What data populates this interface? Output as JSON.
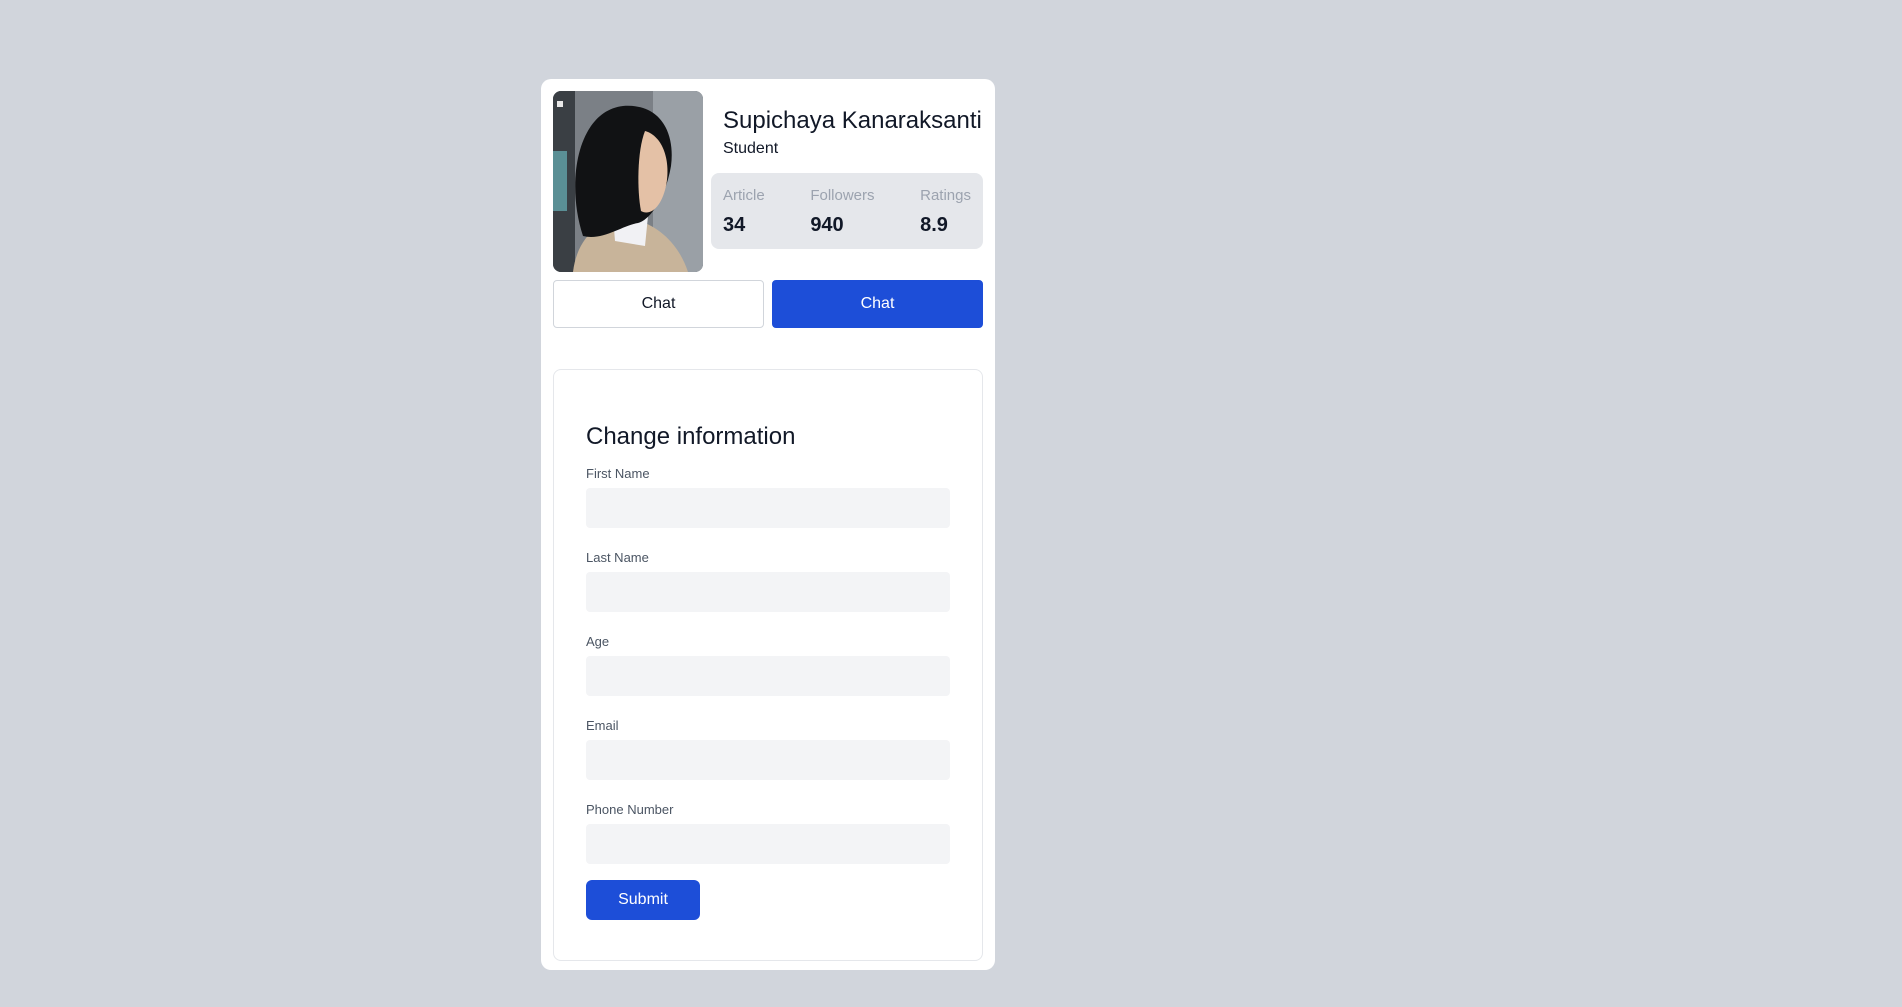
{
  "profile": {
    "name": "Supichaya Kanaraksanti",
    "role": "Student",
    "stats": [
      {
        "label": "Article",
        "value": "34"
      },
      {
        "label": "Followers",
        "value": "940"
      },
      {
        "label": "Ratings",
        "value": "8.9"
      }
    ]
  },
  "actions": {
    "chat_outline_label": "Chat",
    "chat_primary_label": "Chat"
  },
  "form": {
    "title": "Change information",
    "fields": [
      {
        "label": "First Name",
        "value": ""
      },
      {
        "label": "Last Name",
        "value": ""
      },
      {
        "label": "Age",
        "value": ""
      },
      {
        "label": "Email",
        "value": ""
      },
      {
        "label": "Phone Number",
        "value": ""
      }
    ],
    "submit_label": "Submit"
  },
  "colors": {
    "background": "#d1d5dc",
    "accent": "#1d4ed8",
    "stats_bg": "#e5e7eb",
    "input_bg": "#f3f4f6"
  }
}
